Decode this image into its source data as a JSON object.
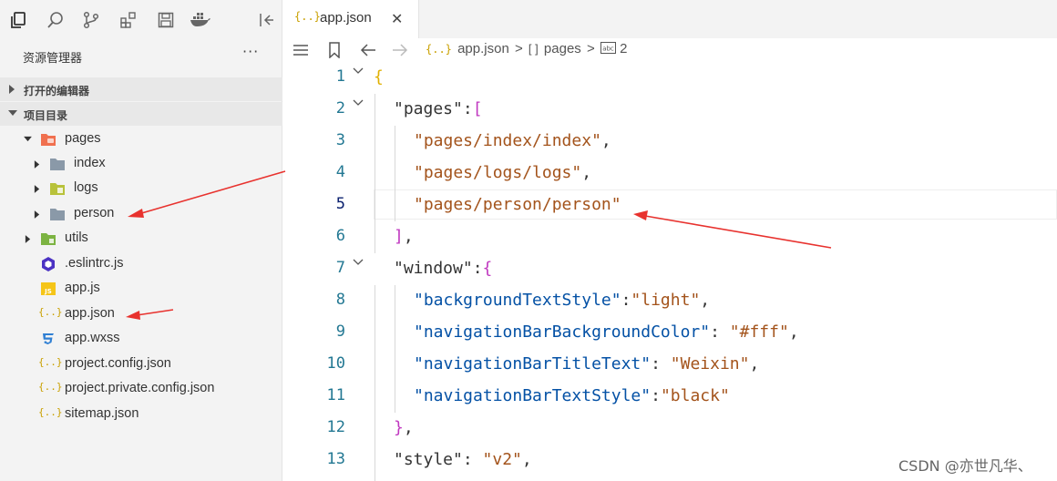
{
  "sidebar": {
    "explorer_title": "资源管理器",
    "more_label": "···",
    "sections": {
      "open_editors": "打开的编辑器",
      "project": "项目目录"
    },
    "tree": [
      {
        "name": "pages",
        "type": "folder-open"
      },
      {
        "name": "index",
        "type": "folder"
      },
      {
        "name": "logs",
        "type": "folder"
      },
      {
        "name": "person",
        "type": "folder"
      },
      {
        "name": "utils",
        "type": "folder"
      },
      {
        "name": ".eslintrc.js",
        "type": "eslint"
      },
      {
        "name": "app.js",
        "type": "js"
      },
      {
        "name": "app.json",
        "type": "json"
      },
      {
        "name": "app.wxss",
        "type": "css"
      },
      {
        "name": "project.config.json",
        "type": "json"
      },
      {
        "name": "project.private.config.json",
        "type": "json"
      },
      {
        "name": "sitemap.json",
        "type": "json"
      }
    ]
  },
  "editor": {
    "tab": {
      "icon": "{..}",
      "label": "app.json",
      "close": "✕"
    },
    "breadcrumb": {
      "file": "app.json",
      "sep1": ">",
      "array_icon": "[ ]",
      "pages": "pages",
      "sep2": ">",
      "index": "2"
    },
    "line_numbers": [
      "1",
      "2",
      "3",
      "4",
      "5",
      "6",
      "7",
      "8",
      "9",
      "10",
      "11",
      "12",
      "13"
    ]
  },
  "code": {
    "l1_open": "{",
    "l2_key": "\"pages\"",
    "l2_colon": ":",
    "l2_bracket": "[",
    "l3_str": "\"pages/index/index\"",
    "l3_comma": ",",
    "l4_str": "\"pages/logs/logs\"",
    "l4_comma": ",",
    "l5_str": "\"pages/person/person\"",
    "l6_bracket": "]",
    "l6_comma": ",",
    "l7_key": "\"window\"",
    "l7_colon": ":",
    "l7_brace": "{",
    "l8_key": "\"backgroundTextStyle\"",
    "l8_colon": ":",
    "l8_val": "\"light\"",
    "l8_comma": ",",
    "l9_key": "\"navigationBarBackgroundColor\"",
    "l9_colon": ": ",
    "l9_val": "\"#fff\"",
    "l9_comma": ",",
    "l10_key": "\"navigationBarTitleText\"",
    "l10_colon": ": ",
    "l10_val": "\"Weixin\"",
    "l10_comma": ",",
    "l11_key": "\"navigationBarTextStyle\"",
    "l11_colon": ":",
    "l11_val": "\"black\"",
    "l12_brace": "}",
    "l12_comma": ",",
    "l13_key": "\"style\"",
    "l13_colon": ": ",
    "l13_val": "\"v2\"",
    "l13_comma": ","
  },
  "watermark": "CSDN @亦世凡华、",
  "colors": {
    "key": "#0451a5",
    "string": "#a3531b",
    "line_number": "#237893",
    "bracket_gold": "#e0b000",
    "bracket_purple": "#c038c0",
    "arrow": "#e8322e"
  }
}
